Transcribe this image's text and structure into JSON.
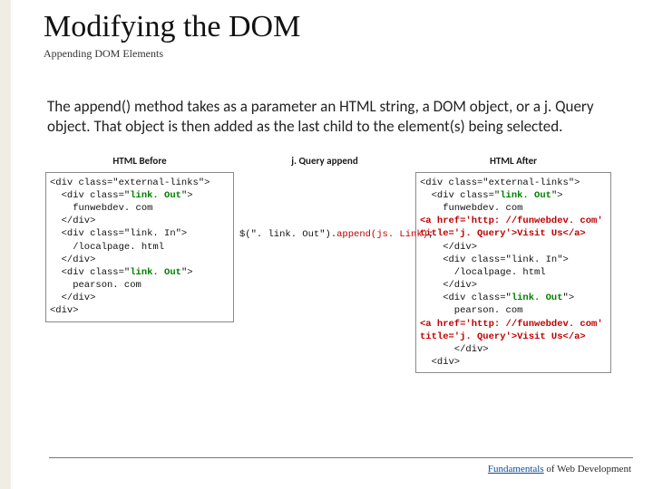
{
  "title": "Modifying the DOM",
  "subtitle": "Appending DOM Elements",
  "body": "The append() method takes as a parameter an HTML string, a DOM object, or a j. Query object. That object is then added as the last child to the element(s) being selected.",
  "columns": {
    "before": {
      "header": "HTML Before",
      "lines": [
        {
          "t": "<div class=\"external-links\">"
        },
        {
          "t": "  <div class=\"",
          "kw": "link. Out",
          "t2": "\">"
        },
        {
          "t": "    funwebdev. com"
        },
        {
          "t": "  </div>"
        },
        {
          "t": "  <div class=\"link. In\">"
        },
        {
          "t": "    /localpage. html"
        },
        {
          "t": "  </div>"
        },
        {
          "t": "  <div class=\"",
          "kw": "link. Out",
          "t2": "\">"
        },
        {
          "t": "    pearson. com"
        },
        {
          "t": "  </div>"
        },
        {
          "t": "<div>"
        }
      ]
    },
    "mid": {
      "header": "j. Query append",
      "code_prefix": "$(\". link. Out\").",
      "code_emph": "append(js. Link)",
      "code_suffix": ";"
    },
    "after": {
      "header": "HTML After",
      "lines": [
        {
          "t": "<div class=\"external-links\">"
        },
        {
          "t": "  <div class=\"",
          "kw": "link. Out",
          "t2": "\">"
        },
        {
          "t": "    funwebdev. com"
        },
        {
          "red": "<a href='http: //funwebdev. com'"
        },
        {
          "red": "title='j. Query'>Visit Us</a>"
        },
        {
          "t": "    </div>"
        },
        {
          "t": "    <div class=\"link. In\">"
        },
        {
          "t": "      /localpage. html"
        },
        {
          "t": "    </div>"
        },
        {
          "t": "    <div class=\"",
          "kw": "link. Out",
          "t2": "\">"
        },
        {
          "t": "      pearson. com"
        },
        {
          "red": "<a href='http: //funwebdev. com'"
        },
        {
          "red": "title='j. Query'>Visit Us</a>"
        },
        {
          "t": "      </div>"
        },
        {
          "t": "  <div>"
        }
      ]
    }
  },
  "footer": {
    "brand": "Fundamentals",
    "rest": " of Web Development"
  }
}
